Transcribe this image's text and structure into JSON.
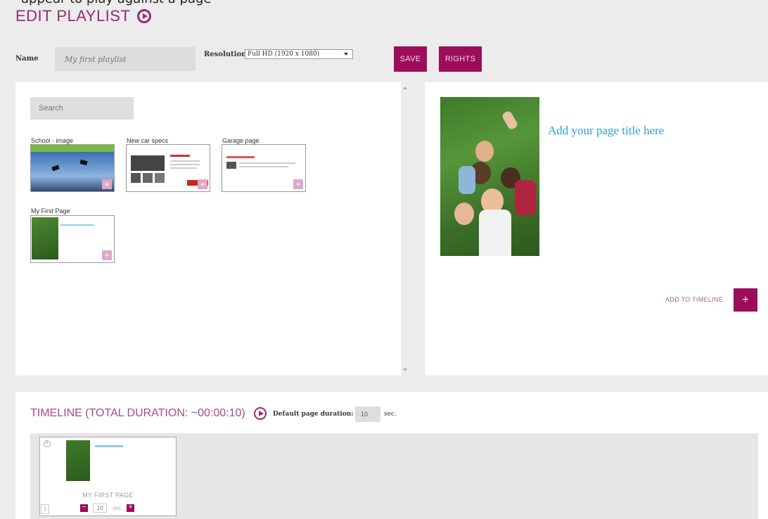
{
  "caption_fragment": "appear to play against a page",
  "page": {
    "title": "EDIT PLAYLIST"
  },
  "form": {
    "name_label": "Name",
    "name_value": "My first playlist",
    "resolution_label": "Resolution",
    "resolution_value": "Full HD (1920 x 1080)"
  },
  "buttons": {
    "save": "SAVE",
    "rights": "RIGHTS"
  },
  "library": {
    "search_placeholder": "Search",
    "items": [
      {
        "label": "School - image"
      },
      {
        "label": "New car specs"
      },
      {
        "label": "Garage page"
      },
      {
        "label": "My First Page"
      }
    ]
  },
  "preview": {
    "page_title": "Add your page title here",
    "add_to_timeline": "ADD TO TIMELINE",
    "add_icon": "+"
  },
  "timeline": {
    "title": "TIMELINE (TOTAL DURATION: ~00:00:10)",
    "default_duration_label": "Default page duration:",
    "default_duration_value": "10",
    "default_duration_unit": "sec.",
    "items": [
      {
        "index": "1",
        "name": "MY FIRST PAGE",
        "seconds": "10",
        "unit": "sec"
      }
    ]
  },
  "colors": {
    "accent": "#9c0d5c",
    "title": "#9a2a6a",
    "link_blue": "#2aa3cf"
  }
}
